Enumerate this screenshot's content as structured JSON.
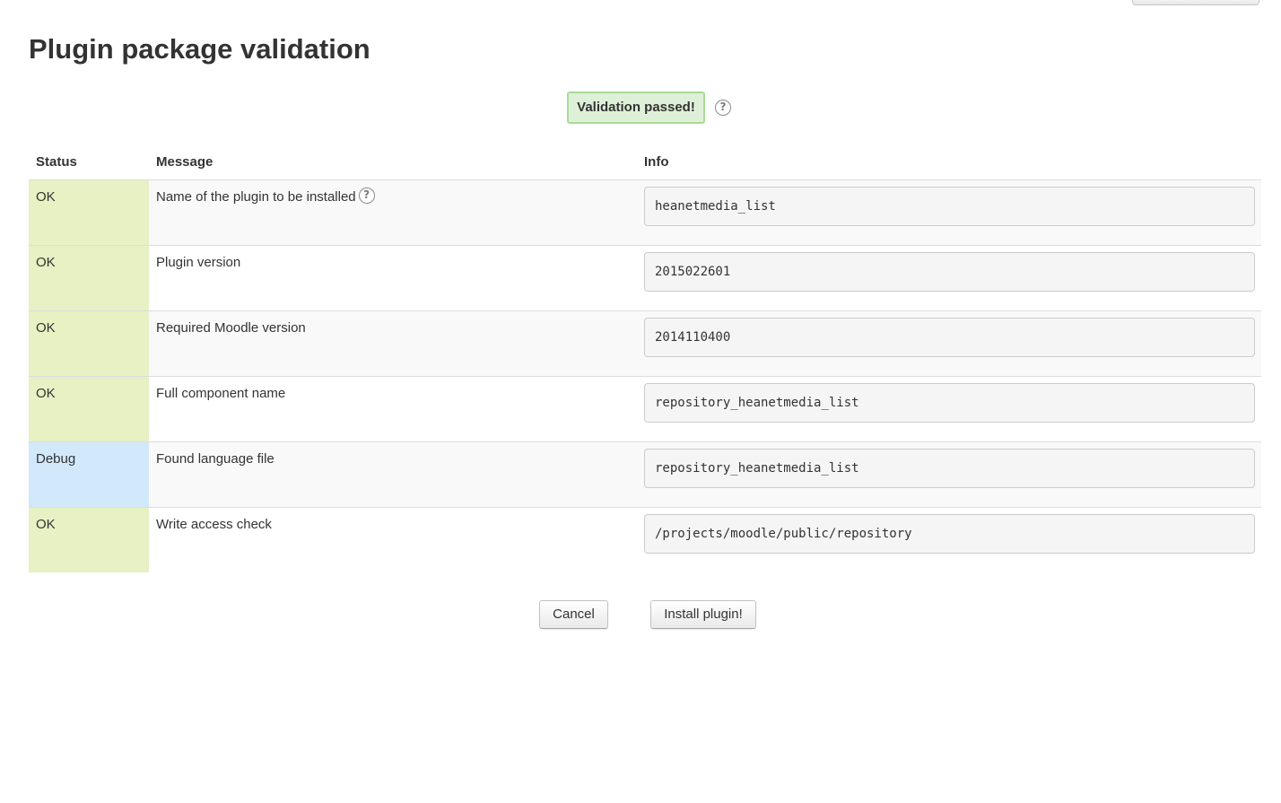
{
  "page": {
    "title": "Plugin package validation"
  },
  "validation": {
    "result": "Validation passed!",
    "help_icon": "help-icon",
    "color_bg": "#dff0d8",
    "color_border": "#a8dc98"
  },
  "table": {
    "headers": {
      "status": "Status",
      "message": "Message",
      "info": "Info"
    },
    "rows": [
      {
        "status": "OK",
        "message": "Name of the plugin to be installed",
        "has_help": true,
        "info": "heanetmedia_list"
      },
      {
        "status": "OK",
        "message": "Plugin version",
        "has_help": false,
        "info": "2015022601"
      },
      {
        "status": "OK",
        "message": "Required Moodle version",
        "has_help": false,
        "info": "2014110400"
      },
      {
        "status": "OK",
        "message": "Full component name",
        "has_help": false,
        "info": "repository_heanetmedia_list"
      },
      {
        "status": "Debug",
        "message": "Found language file",
        "has_help": false,
        "info": "repository_heanetmedia_list"
      },
      {
        "status": "OK",
        "message": "Write access check",
        "has_help": false,
        "info": "/projects/moodle/public/repository"
      }
    ],
    "status_colors": {
      "OK": "#e7f1c3",
      "Debug": "#d2e8fb"
    }
  },
  "buttons": {
    "cancel": "Cancel",
    "install": "Install plugin!"
  }
}
